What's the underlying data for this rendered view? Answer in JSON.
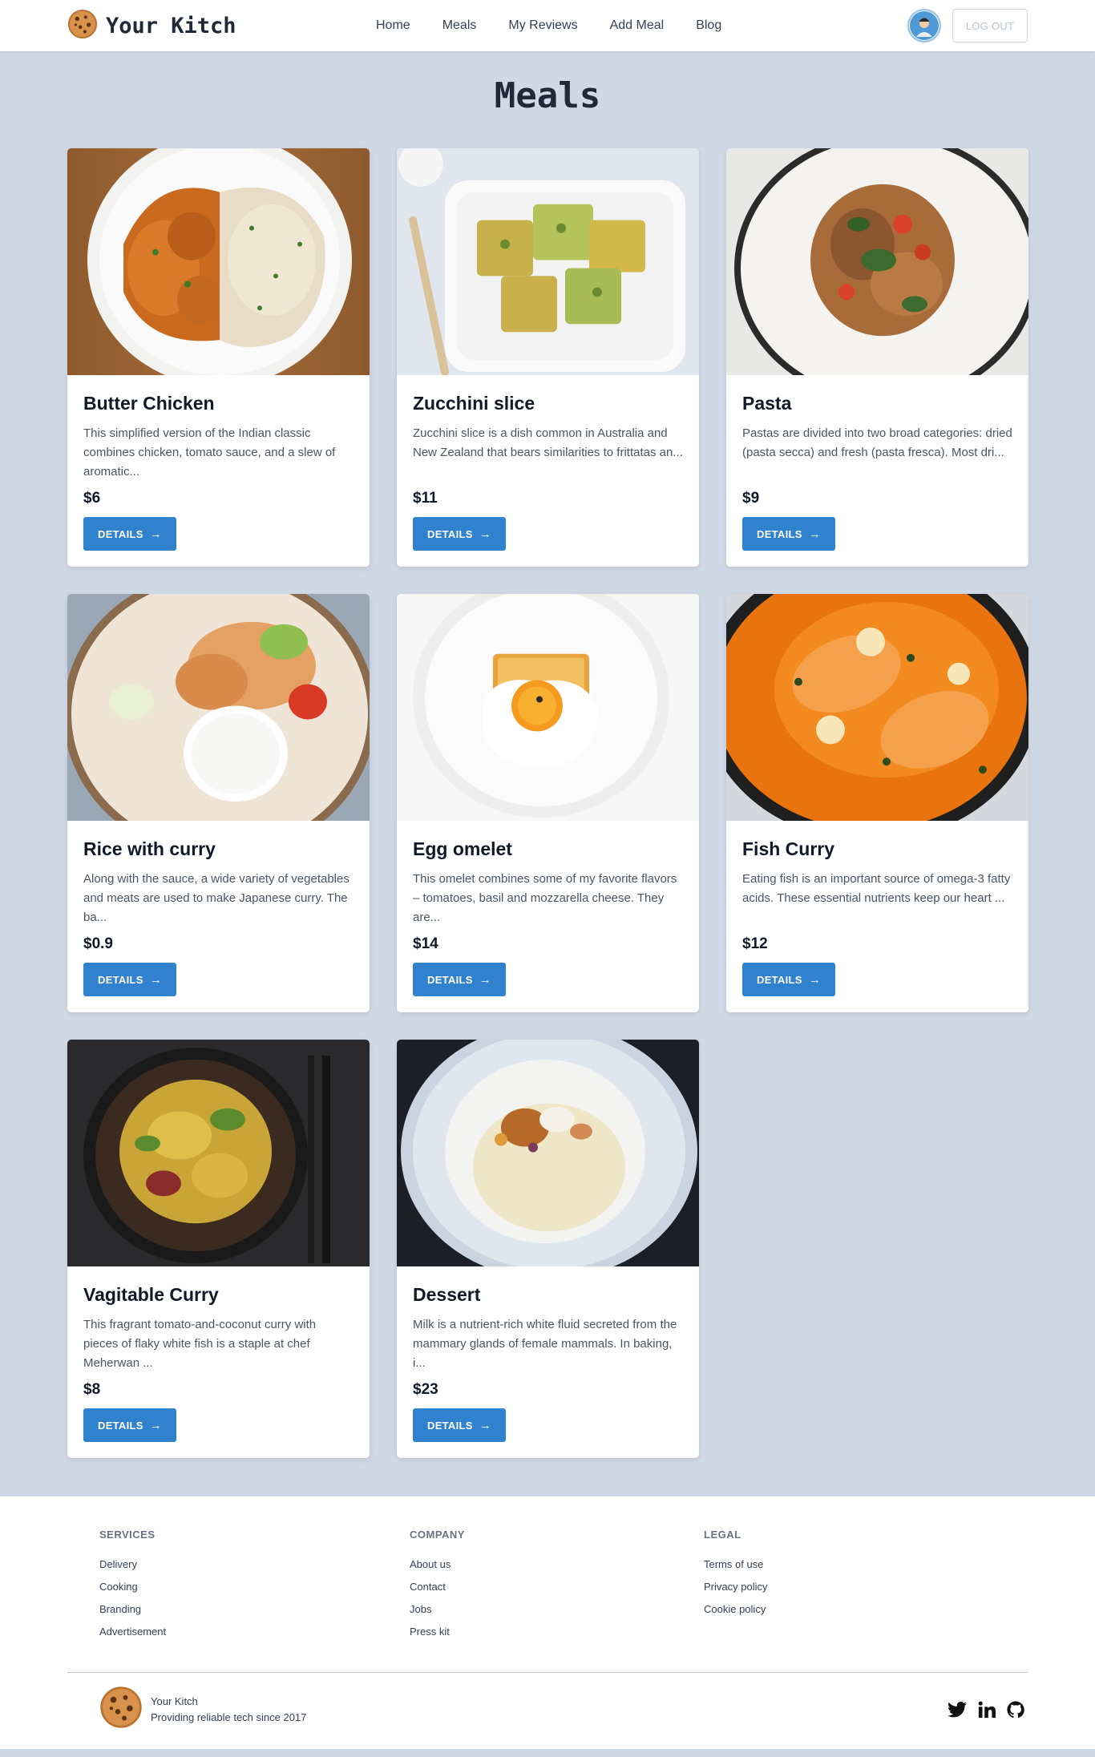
{
  "nav": {
    "brand": "Your Kitch",
    "links": [
      "Home",
      "Meals",
      "My Reviews",
      "Add Meal",
      "Blog"
    ],
    "logout_label": "LOG OUT"
  },
  "page": {
    "title": "Meals"
  },
  "meals": [
    {
      "title": "Butter Chicken",
      "description": "This simplified version of the Indian classic combines chicken, tomato sauce, and a slew of aromatic...",
      "price": "$6",
      "button": "DETAILS"
    },
    {
      "title": "Zucchini slice",
      "description": "Zucchini slice is a dish common in Australia and New Zealand that bears similarities to frittatas an...",
      "price": "$11",
      "button": "DETAILS"
    },
    {
      "title": "Pasta",
      "description": "Pastas are divided into two broad categories: dried (pasta secca) and fresh (pasta fresca). Most dri...",
      "price": "$9",
      "button": "DETAILS"
    },
    {
      "title": "Rice with curry",
      "description": "Along with the sauce, a wide variety of vegetables and meats are used to make Japanese curry. The ba...",
      "price": "$0.9",
      "button": "DETAILS"
    },
    {
      "title": "Egg omelet",
      "description": "This omelet combines some of my favorite flavors – tomatoes, basil and mozzarella cheese. They are...",
      "price": "$14",
      "button": "DETAILS"
    },
    {
      "title": "Fish Curry",
      "description": "Eating fish is an important source of omega-3 fatty acids. These essential nutrients keep our heart ...",
      "price": "$12",
      "button": "DETAILS"
    },
    {
      "title": "Vagitable Curry",
      "description": "This fragrant tomato-and-coconut curry with pieces of flaky white fish is a staple at chef Meherwan ...",
      "price": "$8",
      "button": "DETAILS"
    },
    {
      "title": "Dessert",
      "description": "Milk is a nutrient-rich white fluid secreted from the mammary glands of female mammals. In baking, i...",
      "price": "$23",
      "button": "DETAILS"
    }
  ],
  "footer": {
    "columns": [
      {
        "heading": "SERVICES",
        "links": [
          "Delivery",
          "Cooking",
          "Branding",
          "Advertisement"
        ]
      },
      {
        "heading": "COMPANY",
        "links": [
          "About us",
          "Contact",
          "Jobs",
          "Press kit"
        ]
      },
      {
        "heading": "LEGAL",
        "links": [
          "Terms of use",
          "Privacy policy",
          "Cookie policy"
        ]
      }
    ],
    "brand_name": "Your Kitch",
    "tagline": "Providing reliable tech since 2017",
    "socials": [
      "twitter-icon",
      "linkedin-icon",
      "github-icon"
    ]
  },
  "colors": {
    "page_bg": "#cfd9e5",
    "accent": "#3182ce",
    "card_bg": "#ffffff"
  }
}
